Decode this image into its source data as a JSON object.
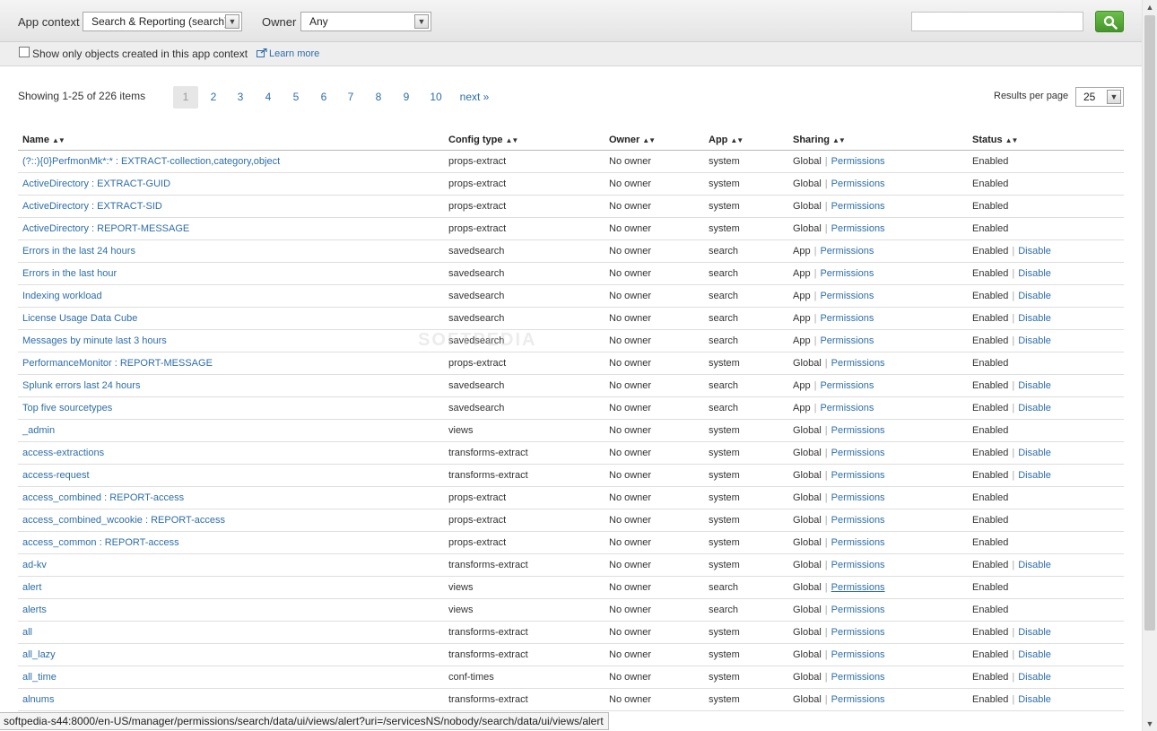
{
  "header": {
    "app_context_label": "App context",
    "app_context_value": "Search & Reporting (search)",
    "owner_label": "Owner",
    "owner_value": "Any",
    "search_value": ""
  },
  "filter": {
    "checkbox_label": "Show only objects created in this app context",
    "learn_more": "Learn more"
  },
  "pagination": {
    "showing": "Showing 1-25 of 226 items",
    "pages": [
      "1",
      "2",
      "3",
      "4",
      "5",
      "6",
      "7",
      "8",
      "9",
      "10"
    ],
    "next": "next »",
    "results_per_page_label": "Results per page",
    "results_per_page_value": "25"
  },
  "table": {
    "columns": [
      "Name",
      "Config type",
      "Owner",
      "App",
      "Sharing",
      "Status"
    ],
    "rows": [
      {
        "name": "(?::){0}PerfmonMk*:* : EXTRACT-collection,category,object",
        "type": "props-extract",
        "owner": "No owner",
        "app": "system",
        "sharing": "Global",
        "status": "Enabled",
        "disable": ""
      },
      {
        "name": "ActiveDirectory : EXTRACT-GUID",
        "type": "props-extract",
        "owner": "No owner",
        "app": "system",
        "sharing": "Global",
        "status": "Enabled",
        "disable": ""
      },
      {
        "name": "ActiveDirectory : EXTRACT-SID",
        "type": "props-extract",
        "owner": "No owner",
        "app": "system",
        "sharing": "Global",
        "status": "Enabled",
        "disable": ""
      },
      {
        "name": "ActiveDirectory : REPORT-MESSAGE",
        "type": "props-extract",
        "owner": "No owner",
        "app": "system",
        "sharing": "Global",
        "status": "Enabled",
        "disable": ""
      },
      {
        "name": "Errors in the last 24 hours",
        "type": "savedsearch",
        "owner": "No owner",
        "app": "search",
        "sharing": "App",
        "status": "Enabled",
        "disable": "Disable"
      },
      {
        "name": "Errors in the last hour",
        "type": "savedsearch",
        "owner": "No owner",
        "app": "search",
        "sharing": "App",
        "status": "Enabled",
        "disable": "Disable"
      },
      {
        "name": "Indexing workload",
        "type": "savedsearch",
        "owner": "No owner",
        "app": "search",
        "sharing": "App",
        "status": "Enabled",
        "disable": "Disable"
      },
      {
        "name": "License Usage Data Cube",
        "type": "savedsearch",
        "owner": "No owner",
        "app": "search",
        "sharing": "App",
        "status": "Enabled",
        "disable": "Disable"
      },
      {
        "name": "Messages by minute last 3 hours",
        "type": "savedsearch",
        "owner": "No owner",
        "app": "search",
        "sharing": "App",
        "status": "Enabled",
        "disable": "Disable"
      },
      {
        "name": "PerformanceMonitor : REPORT-MESSAGE",
        "type": "props-extract",
        "owner": "No owner",
        "app": "system",
        "sharing": "Global",
        "status": "Enabled",
        "disable": ""
      },
      {
        "name": "Splunk errors last 24 hours",
        "type": "savedsearch",
        "owner": "No owner",
        "app": "search",
        "sharing": "App",
        "status": "Enabled",
        "disable": "Disable"
      },
      {
        "name": "Top five sourcetypes",
        "type": "savedsearch",
        "owner": "No owner",
        "app": "search",
        "sharing": "App",
        "status": "Enabled",
        "disable": "Disable"
      },
      {
        "name": "_admin",
        "type": "views",
        "owner": "No owner",
        "app": "system",
        "sharing": "Global",
        "status": "Enabled",
        "disable": ""
      },
      {
        "name": "access-extractions",
        "type": "transforms-extract",
        "owner": "No owner",
        "app": "system",
        "sharing": "Global",
        "status": "Enabled",
        "disable": "Disable"
      },
      {
        "name": "access-request",
        "type": "transforms-extract",
        "owner": "No owner",
        "app": "system",
        "sharing": "Global",
        "status": "Enabled",
        "disable": "Disable"
      },
      {
        "name": "access_combined : REPORT-access",
        "type": "props-extract",
        "owner": "No owner",
        "app": "system",
        "sharing": "Global",
        "status": "Enabled",
        "disable": ""
      },
      {
        "name": "access_combined_wcookie : REPORT-access",
        "type": "props-extract",
        "owner": "No owner",
        "app": "system",
        "sharing": "Global",
        "status": "Enabled",
        "disable": ""
      },
      {
        "name": "access_common : REPORT-access",
        "type": "props-extract",
        "owner": "No owner",
        "app": "system",
        "sharing": "Global",
        "status": "Enabled",
        "disable": ""
      },
      {
        "name": "ad-kv",
        "type": "transforms-extract",
        "owner": "No owner",
        "app": "system",
        "sharing": "Global",
        "status": "Enabled",
        "disable": "Disable"
      },
      {
        "name": "alert",
        "type": "views",
        "owner": "No owner",
        "app": "search",
        "sharing": "Global",
        "status": "Enabled",
        "disable": "",
        "hover": true
      },
      {
        "name": "alerts",
        "type": "views",
        "owner": "No owner",
        "app": "search",
        "sharing": "Global",
        "status": "Enabled",
        "disable": ""
      },
      {
        "name": "all",
        "type": "transforms-extract",
        "owner": "No owner",
        "app": "system",
        "sharing": "Global",
        "status": "Enabled",
        "disable": "Disable"
      },
      {
        "name": "all_lazy",
        "type": "transforms-extract",
        "owner": "No owner",
        "app": "system",
        "sharing": "Global",
        "status": "Enabled",
        "disable": "Disable"
      },
      {
        "name": "all_time",
        "type": "conf-times",
        "owner": "No owner",
        "app": "system",
        "sharing": "Global",
        "status": "Enabled",
        "disable": "Disable"
      },
      {
        "name": "alnums",
        "type": "transforms-extract",
        "owner": "No owner",
        "app": "system",
        "sharing": "Global",
        "status": "Enabled",
        "disable": "Disable"
      }
    ],
    "permissions_label": "Permissions"
  },
  "statusbar": {
    "url": "softpedia-s44:8000/en-US/manager/permissions/search/data/ui/views/alert?uri=/servicesNS/nobody/search/data/ui/views/alert"
  },
  "watermark": "SOFTPEDIA",
  "colors": {
    "link": "#2d6ea8",
    "search_button": "#45962a",
    "header_bg": "#e4e4e4"
  },
  "icons": {
    "search_button": "magnifier-icon",
    "learn_more": "external-link-icon",
    "dropdown": "chevron-down-icon",
    "sort": "sort-arrows-icon"
  }
}
